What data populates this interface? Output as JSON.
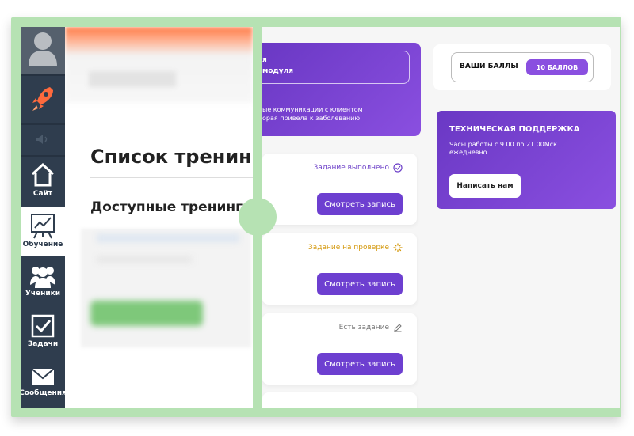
{
  "sidebar": {
    "items": [
      {
        "label": "Сайт"
      },
      {
        "label": "Обучение"
      },
      {
        "label": "Ученики"
      },
      {
        "label": "Задачи"
      },
      {
        "label": "Сообщения"
      }
    ]
  },
  "left_panel": {
    "title": "Список тренинг",
    "subtitle": "Доступные тренинги"
  },
  "module_card": {
    "line_top": "я",
    "line_module": "модуля",
    "desc1": "ые коммуникации с клиентом",
    "desc2": "орая привела к заболеванию"
  },
  "tasks": [
    {
      "status": "Задание выполнено",
      "status_icon": "check-circle-icon",
      "button": "Смотреть запись"
    },
    {
      "status": "Задание на проверке",
      "status_icon": "spinner-icon",
      "button": "Смотреть запись"
    },
    {
      "status": "Есть задание",
      "status_icon": "pencil-icon",
      "button": "Смотреть запись"
    }
  ],
  "score": {
    "label": "ВАШИ БАЛЛЫ",
    "value": "10 БАЛЛОВ"
  },
  "support": {
    "title": "ТЕХНИЧЕСКАЯ ПОДДЕРЖКА",
    "hours": "Часы работы с 9.00 по 21.00Мск ежедневно",
    "button": "Написать нам"
  },
  "colors": {
    "accent_purple": "#6d3fd0",
    "sidebar_bg": "#2f3d4e",
    "frame_green": "#b6e2b3",
    "status_done": "#6c3fc8",
    "status_check": "#d59a10",
    "rocket": "#ff6a3d"
  }
}
